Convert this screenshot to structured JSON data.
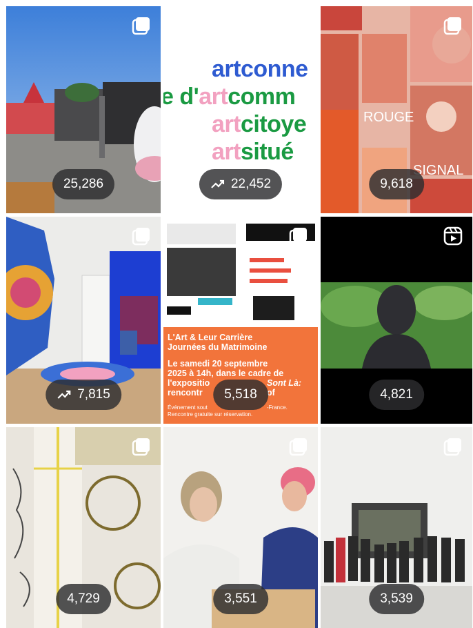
{
  "tiles": [
    {
      "id": "t1",
      "views": "25,286",
      "trending": false,
      "corner": "carousel-icon"
    },
    {
      "id": "t2",
      "views": "22,452",
      "trending": true,
      "corner": "none",
      "lines": [
        {
          "a": "art",
          "b": "conne"
        },
        {
          "a": "e d'",
          "b": "art",
          "c": "comm"
        },
        {
          "a": "art",
          "b": "citoye"
        },
        {
          "a": "art",
          "b": "situé"
        }
      ]
    },
    {
      "id": "t3",
      "views": "9,618",
      "trending": false,
      "corner": "carousel-icon",
      "words": [
        "ROUGE",
        "SIGNAL"
      ]
    },
    {
      "id": "t4",
      "views": "7,815",
      "trending": true,
      "corner": "carousel-icon"
    },
    {
      "id": "t5",
      "views": "5,518",
      "trending": false,
      "corner": "carousel-icon",
      "poster": {
        "line1": "L'Art & Leur Carrière",
        "line2": "Journées du Matrimoine",
        "line3": "Le samedi 20 septembre",
        "line4": "2025 à 14h, dans le cadre de",
        "line5": "l'expositio",
        "line5b": "Sont Là:",
        "line6": "rencontr",
        "line6b": "of",
        "line7": "Événement sout",
        "line7b": "-France.",
        "line8": "Rencontre gratuite sur réservation."
      }
    },
    {
      "id": "t6",
      "views": "4,821",
      "trending": false,
      "corner": "reels-icon"
    },
    {
      "id": "t7",
      "views": "4,729",
      "trending": false,
      "corner": "carousel-icon"
    },
    {
      "id": "t8",
      "views": "3,551",
      "trending": false,
      "corner": "carousel-icon"
    },
    {
      "id": "t9",
      "views": "3,539",
      "trending": false,
      "corner": "carousel-icon"
    }
  ],
  "colors": {
    "blue": "#2e5bd1",
    "green": "#1a9a42",
    "pink": "#f2a1c0",
    "orange": "#f2743b",
    "badge": "#2d2d30"
  }
}
